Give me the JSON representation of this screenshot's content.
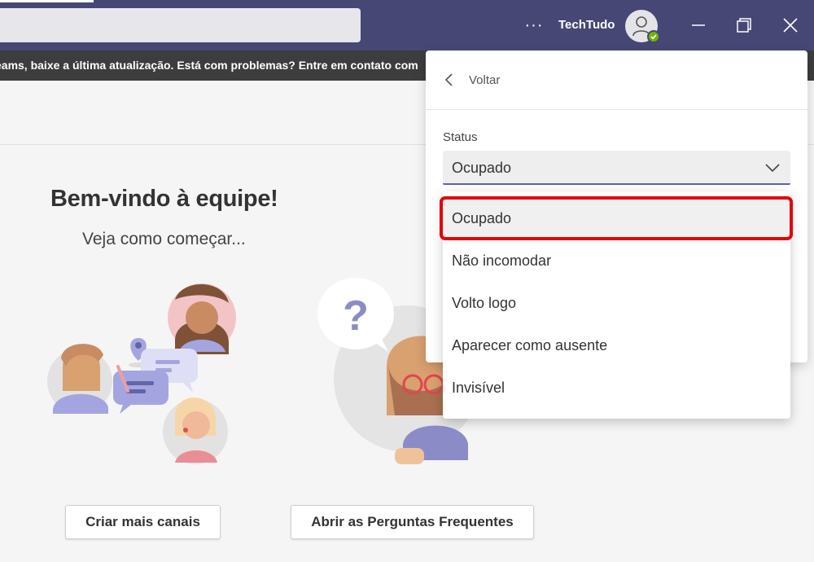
{
  "titlebar": {
    "more_label": "···",
    "account_name": "TechTudo",
    "brand_color": "#464775",
    "presence_color": "#6bb700"
  },
  "banner": {
    "text": "eams, baixe a última atualização. Está com problemas? Entre em contato com"
  },
  "welcome": {
    "title": "Bem-vindo à equipe!",
    "subtitle": "Veja como começar..."
  },
  "actions": {
    "create_channels": "Criar mais canais",
    "open_faq": "Abrir as Perguntas Frequentes"
  },
  "status_panel": {
    "back_label": "Voltar",
    "status_label": "Status",
    "selected_value": "Ocupado",
    "options": [
      {
        "label": "Ocupado"
      },
      {
        "label": "Não incomodar"
      },
      {
        "label": "Volto logo"
      },
      {
        "label": "Aparecer como ausente"
      },
      {
        "label": "Invisível"
      }
    ]
  },
  "illustration_glyph": "?",
  "colors": {
    "highlight": "#e3040a",
    "accent": "#5b5fc7"
  }
}
